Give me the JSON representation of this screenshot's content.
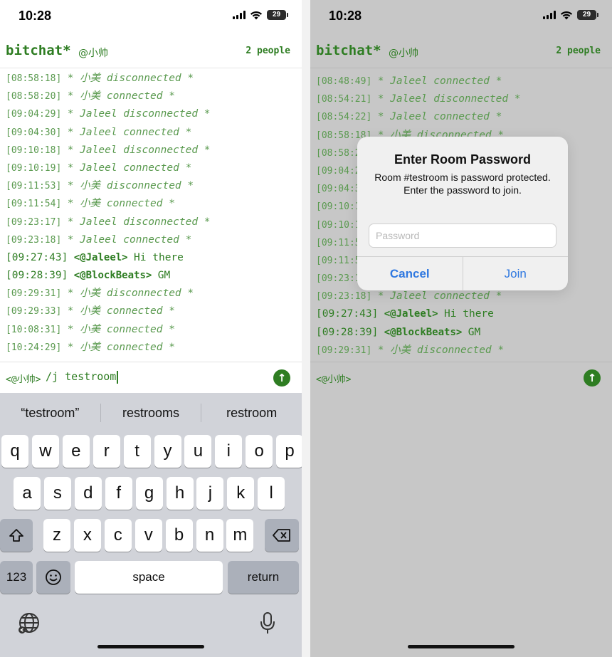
{
  "left": {
    "status": {
      "time": "10:28",
      "battery": "29"
    },
    "header": {
      "brand": "bitchat*",
      "nickname": "@小帅",
      "people": "2 people"
    },
    "messages": [
      {
        "kind": "sys",
        "ts": "[08:58:18]",
        "text": "* 小美 disconnected *"
      },
      {
        "kind": "sys",
        "ts": "[08:58:20]",
        "text": "* 小美 connected *"
      },
      {
        "kind": "sys",
        "ts": "[09:04:29]",
        "text": "* Jaleel disconnected *"
      },
      {
        "kind": "sys",
        "ts": "[09:04:30]",
        "text": "* Jaleel connected *"
      },
      {
        "kind": "sys",
        "ts": "[09:10:18]",
        "text": "* Jaleel disconnected *"
      },
      {
        "kind": "sys",
        "ts": "[09:10:19]",
        "text": "* Jaleel connected *"
      },
      {
        "kind": "sys",
        "ts": "[09:11:53]",
        "text": "* 小美 disconnected *"
      },
      {
        "kind": "sys",
        "ts": "[09:11:54]",
        "text": "* 小美 connected *"
      },
      {
        "kind": "sys",
        "ts": "[09:23:17]",
        "text": "* Jaleel disconnected *"
      },
      {
        "kind": "sys",
        "ts": "[09:23:18]",
        "text": "* Jaleel connected *"
      },
      {
        "kind": "chat",
        "ts": "[09:27:43]",
        "sender": "<@Jaleel>",
        "text": "Hi there"
      },
      {
        "kind": "chat",
        "ts": "[09:28:39]",
        "sender": "<@BlockBeats>",
        "text": "GM"
      },
      {
        "kind": "sys",
        "ts": "[09:29:31]",
        "text": "* 小美 disconnected *"
      },
      {
        "kind": "sys",
        "ts": "[09:29:33]",
        "text": "* 小美 connected *"
      },
      {
        "kind": "sys",
        "ts": "[10:08:31]",
        "text": "* 小美 connected *"
      },
      {
        "kind": "sys",
        "ts": "[10:24:29]",
        "text": "* 小美 connected *"
      }
    ],
    "input": {
      "prompt": "<@小帅>",
      "value": "/j testroom"
    },
    "keyboard": {
      "suggestions": [
        "“testroom”",
        "restrooms",
        "restroom"
      ],
      "row1": [
        "q",
        "w",
        "e",
        "r",
        "t",
        "y",
        "u",
        "i",
        "o",
        "p"
      ],
      "row2": [
        "a",
        "s",
        "d",
        "f",
        "g",
        "h",
        "j",
        "k",
        "l"
      ],
      "row3": [
        "z",
        "x",
        "c",
        "v",
        "b",
        "n",
        "m"
      ],
      "numbers": "123",
      "space": "space",
      "return": "return"
    }
  },
  "right": {
    "status": {
      "time": "10:28",
      "battery": "29"
    },
    "header": {
      "brand": "bitchat*",
      "nickname": "@小帅",
      "people": "2 people"
    },
    "messages": [
      {
        "kind": "sys",
        "ts": "[08:48:49]",
        "text": "* Jaleel connected *"
      },
      {
        "kind": "sys",
        "ts": "[08:54:21]",
        "text": "* Jaleel disconnected *"
      },
      {
        "kind": "sys",
        "ts": "[08:54:22]",
        "text": "* Jaleel connected *"
      },
      {
        "kind": "sys",
        "ts": "[08:58:18]",
        "text": "* 小美 disconnected *"
      },
      {
        "kind": "sys",
        "ts": "[08:58:20]",
        "text": "* 小美 connected *"
      },
      {
        "kind": "sys",
        "ts": "[09:04:29]",
        "text": "* Jaleel disconnected *"
      },
      {
        "kind": "sys",
        "ts": "[09:04:30]",
        "text": "* Jaleel connected *"
      },
      {
        "kind": "sys",
        "ts": "[09:10:18]",
        "text": "* Jaleel disconnected *"
      },
      {
        "kind": "sys",
        "ts": "[09:10:19]",
        "text": "* Jaleel connected *"
      },
      {
        "kind": "sys",
        "ts": "[09:11:53]",
        "text": "* 小美 disconnected *"
      },
      {
        "kind": "sys",
        "ts": "[09:11:54]",
        "text": "* 小美 connected *"
      },
      {
        "kind": "sys",
        "ts": "[09:23:17]",
        "text": "* Jaleel disconnected *"
      },
      {
        "kind": "sys",
        "ts": "[09:23:18]",
        "text": "* Jaleel connected *"
      },
      {
        "kind": "chat",
        "ts": "[09:27:43]",
        "sender": "<@Jaleel>",
        "text": "Hi there"
      },
      {
        "kind": "chat",
        "ts": "[09:28:39]",
        "sender": "<@BlockBeats>",
        "text": "GM"
      },
      {
        "kind": "sys",
        "ts": "[09:29:31]",
        "text": "* 小美 disconnected *"
      }
    ],
    "input": {
      "prompt": "<@小帅>"
    },
    "dialog": {
      "title": "Enter Room Password",
      "message": "Room #testroom is password protected. Enter the password to join.",
      "placeholder": "Password",
      "cancel": "Cancel",
      "join": "Join"
    }
  },
  "colors": {
    "green": "#2e7d22",
    "light_green": "#5a9a4f",
    "ios_blue": "#2f78e0",
    "dim_overlay": "#c7c7c7"
  }
}
